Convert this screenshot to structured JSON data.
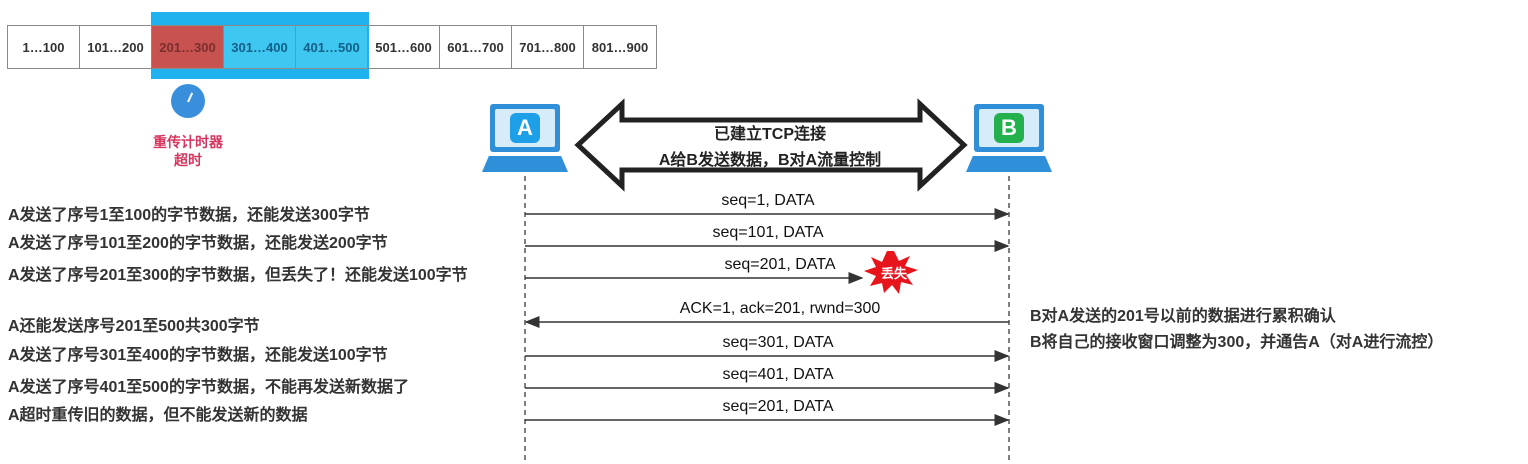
{
  "sequence_segments": [
    {
      "label": "1…100",
      "state": "normal"
    },
    {
      "label": "101…200",
      "state": "normal"
    },
    {
      "label": "201…300",
      "state": "lost"
    },
    {
      "label": "301…400",
      "state": "window"
    },
    {
      "label": "401…500",
      "state": "window"
    },
    {
      "label": "501…600",
      "state": "normal"
    },
    {
      "label": "601…700",
      "state": "normal"
    },
    {
      "label": "701…800",
      "state": "normal"
    },
    {
      "label": "801…900",
      "state": "normal"
    }
  ],
  "timer": {
    "label_line1": "重传计时器",
    "label_line2": "超时",
    "icon": "clock-icon"
  },
  "hosts": {
    "a": "A",
    "b": "B"
  },
  "connection": {
    "line1": "已建立TCP连接",
    "line2": "A给B发送数据，B对A流量控制"
  },
  "messages": [
    {
      "text": "seq=1, DATA",
      "direction": "A->B"
    },
    {
      "text": "seq=101, DATA",
      "direction": "A->B"
    },
    {
      "text": "seq=201, DATA",
      "direction": "A->B",
      "lost": true
    },
    {
      "text": "ACK=1, ack=201, rwnd=300",
      "direction": "B->A"
    },
    {
      "text": "seq=301, DATA",
      "direction": "A->B"
    },
    {
      "text": "seq=401, DATA",
      "direction": "A->B"
    },
    {
      "text": "seq=201, DATA",
      "direction": "A->B"
    }
  ],
  "lost_label": "丢失",
  "left_notes": [
    "A发送了序号1至100的字节数据，还能发送300字节",
    "A发送了序号101至200的字节数据，还能发送200字节",
    "A发送了序号201至300的字节数据，但丢失了！还能发送100字节",
    "A还能发送序号201至500共300字节",
    "A发送了序号301至400的字节数据，还能发送100字节",
    "A发送了序号401至500的字节数据，不能再发送新数据了",
    "A超时重传旧的数据，但不能发送新的数据"
  ],
  "right_notes": [
    "B对A发送的201号以前的数据进行累积确认",
    "B将自己的接收窗口调整为300，并通告A（对A进行流控）"
  ],
  "colors": {
    "window": "#1fb2ef",
    "lost": "#c8524f",
    "host_a": "#1ea0e8",
    "host_b": "#22b14c",
    "burst": "#e8141c"
  }
}
